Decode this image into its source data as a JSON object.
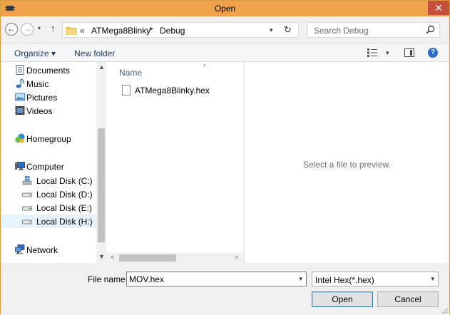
{
  "window": {
    "title": "Open",
    "close_glyph": "✕"
  },
  "nav": {
    "back_glyph": "←",
    "forward_glyph": "→",
    "recent_glyph": "▾",
    "up_glyph": "↑",
    "breadcrumb": {
      "overflow": "«",
      "items": [
        "ATMega8Blinky",
        "Debug"
      ],
      "separator": "▸"
    },
    "refresh_glyph": "↻",
    "dropdown_glyph": "▾",
    "search_placeholder": "Search Debug"
  },
  "commandbar": {
    "organize_label": "Organize ▾",
    "new_folder_label": "New folder",
    "view_dropdown_glyph": "▾",
    "help_glyph": "?"
  },
  "sidebar": {
    "items": [
      {
        "label": "Documents",
        "icon": "documents-icon",
        "color": "#5a6e8c"
      },
      {
        "label": "Music",
        "icon": "music-icon",
        "color": "#3a6fb8"
      },
      {
        "label": "Pictures",
        "icon": "pictures-icon",
        "color": "#4a88c8"
      },
      {
        "label": "Videos",
        "icon": "videos-icon",
        "color": "#333333"
      },
      {
        "label": "Homegroup",
        "icon": "homegroup-icon",
        "color": "#2a8bd0"
      },
      {
        "label": "Computer",
        "icon": "computer-icon",
        "color": "#2a6cc9"
      },
      {
        "label": "Local Disk (C:)",
        "icon": "drive-windows-icon",
        "color": "#3a7fd0"
      },
      {
        "label": "Local Disk (D:)",
        "icon": "drive-icon",
        "color": "#808080"
      },
      {
        "label": "Local Disk (E:)",
        "icon": "drive-icon",
        "color": "#808080"
      },
      {
        "label": "Local Disk (H:)",
        "icon": "drive-icon",
        "color": "#808080",
        "selected": true
      },
      {
        "label": "Network",
        "icon": "network-icon",
        "color": "#2a6cc9"
      }
    ],
    "scroll_up_glyph": "▲",
    "scroll_down_glyph": "▼"
  },
  "filelist": {
    "column_header": "Name",
    "sort_glyph": "^",
    "files": [
      {
        "name": "ATMega8Blinky.hex"
      }
    ],
    "scroll_left_glyph": "<",
    "scroll_right_glyph": ">"
  },
  "preview": {
    "message": "Select a file to preview."
  },
  "footer": {
    "file_name_label": "File name:",
    "file_name_value": "MOV.hex",
    "file_type_value": "Intel Hex(*.hex)",
    "dropdown_glyph": "▾",
    "open_label": "Open",
    "cancel_label": "Cancel"
  },
  "colors": {
    "titlebar": "#f0a24a",
    "close_button": "#c7503c",
    "link_text": "#1e395b",
    "selection": "#e5f3ff"
  }
}
